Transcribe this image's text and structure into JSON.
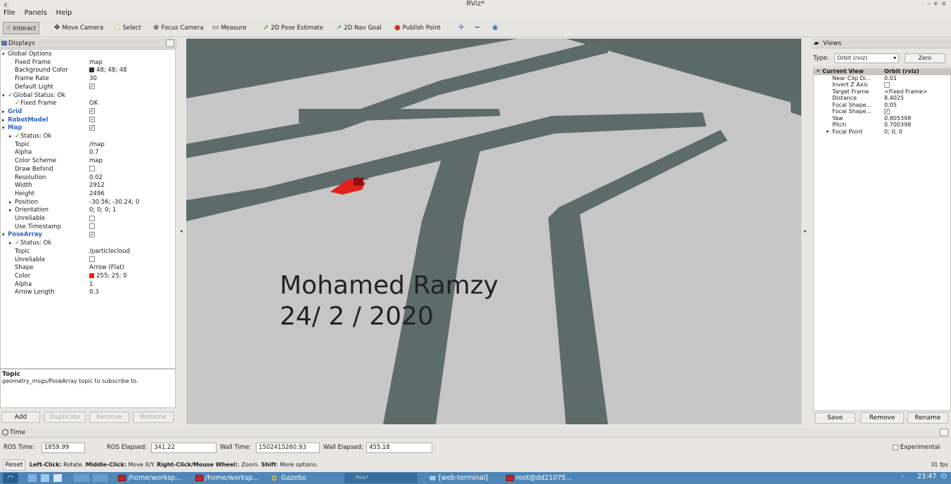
{
  "window": {
    "title": "RViz*",
    "controls": "– + ×"
  },
  "menu": [
    "File",
    "Panels",
    "Help"
  ],
  "toolbar": [
    {
      "label": "Interact",
      "icon": "interact-icon"
    },
    {
      "label": "Move Camera",
      "icon": "move-camera-icon"
    },
    {
      "label": "Select",
      "icon": "select-icon"
    },
    {
      "label": "Focus Camera",
      "icon": "focus-camera-icon"
    },
    {
      "label": "Measure",
      "icon": "measure-icon"
    },
    {
      "label": "2D Pose Estimate",
      "icon": "pose-estimate-icon"
    },
    {
      "label": "2D Nav Goal",
      "icon": "nav-goal-icon"
    },
    {
      "label": "Publish Point",
      "icon": "publish-point-icon"
    }
  ],
  "displays": {
    "title": "Displays",
    "rows": [
      {
        "k": "Global Options",
        "v": ""
      },
      {
        "k": "Fixed Frame",
        "v": "map"
      },
      {
        "k": "Background Color",
        "v": "48; 48; 48"
      },
      {
        "k": "Frame Rate",
        "v": "30"
      },
      {
        "k": "Default Light",
        "v": "✓"
      },
      {
        "k": "Global Status: Ok",
        "v": ""
      },
      {
        "k": "Fixed Frame",
        "v": "OK"
      },
      {
        "k": "Grid",
        "v": "✓"
      },
      {
        "k": "RobotModel",
        "v": "✓"
      },
      {
        "k": "Map",
        "v": "✓"
      },
      {
        "k": "Status: Ok",
        "v": ""
      },
      {
        "k": "Topic",
        "v": "/map"
      },
      {
        "k": "Alpha",
        "v": "0.7"
      },
      {
        "k": "Color Scheme",
        "v": "map"
      },
      {
        "k": "Draw Behind",
        "v": ""
      },
      {
        "k": "Resolution",
        "v": "0.02"
      },
      {
        "k": "Width",
        "v": "2912"
      },
      {
        "k": "Height",
        "v": "2496"
      },
      {
        "k": "Position",
        "v": "-30.56; -30.24; 0"
      },
      {
        "k": "Orientation",
        "v": "0; 0; 0; 1"
      },
      {
        "k": "Unreliable",
        "v": ""
      },
      {
        "k": "Use Timestamp",
        "v": ""
      },
      {
        "k": "PoseArray",
        "v": "✓"
      },
      {
        "k": "Status: Ok",
        "v": ""
      },
      {
        "k": "Topic",
        "v": "/particlecloud"
      },
      {
        "k": "Unreliable",
        "v": ""
      },
      {
        "k": "Shape",
        "v": "Arrow (Flat)"
      },
      {
        "k": "Color",
        "v": "255; 25; 0"
      },
      {
        "k": "Alpha",
        "v": "1"
      },
      {
        "k": "Arrow Length",
        "v": "0.3"
      }
    ],
    "desc_title": "Topic",
    "desc_text": "geometry_msgs/PoseArray topic to subscribe to.",
    "buttons": [
      "Add",
      "Duplicate",
      "Remove",
      "Rename"
    ]
  },
  "views": {
    "title": "Views",
    "type_label": "Type:",
    "type_value": "Orbit (rviz)",
    "zero_label": "Zero",
    "rows": [
      {
        "k": "Current View",
        "v": "Orbit (rviz)"
      },
      {
        "k": "Near Clip Di...",
        "v": "0.01"
      },
      {
        "k": "Invert Z Axis",
        "v": ""
      },
      {
        "k": "Target Frame",
        "v": "<Fixed Frame>"
      },
      {
        "k": "Distance",
        "v": "8.4025"
      },
      {
        "k": "Focal Shape...",
        "v": "0.05"
      },
      {
        "k": "Focal Shape...",
        "v": "✓"
      },
      {
        "k": "Yaw",
        "v": "0.805398"
      },
      {
        "k": "Pitch",
        "v": "0.700398"
      },
      {
        "k": "Focal Point",
        "v": "0; 0; 0"
      }
    ],
    "buttons": [
      "Save",
      "Remove",
      "Rename"
    ]
  },
  "overlay": {
    "line1": "Mohamed Ramzy",
    "line2": "24/ 2 / 2020"
  },
  "time": {
    "title": "Time",
    "ros_time_label": "ROS Time:",
    "ros_time": "1859.99",
    "ros_elapsed_label": "ROS Elapsed:",
    "ros_elapsed": "341.22",
    "wall_time_label": "Wall Time:",
    "wall_time": "1502415260.93",
    "wall_elapsed_label": "Wall Elapsed:",
    "wall_elapsed": "455.18",
    "experimental": "Experimental"
  },
  "hint": {
    "reset": "Reset",
    "b1": "Left-Click:",
    "t1": " Rotate. ",
    "b2": "Middle-Click:",
    "t2": " Move X/Y. ",
    "b3": "Right-Click/Mouse Wheel:",
    "t3": ": Zoom. ",
    "b4": "Shift",
    "t4": ": More options.",
    "fps": "31 fps"
  },
  "taskbar": {
    "tasks": [
      "/home/worksp...",
      "/home/worksp...",
      "Gazebo",
      "RViz*",
      "[web-terminal]",
      "root@dd21075..."
    ],
    "clock": "23:47"
  },
  "colors": {
    "floor": "#c9c9c9",
    "wall": "#5d6b6b",
    "robot": "#e0201a"
  }
}
